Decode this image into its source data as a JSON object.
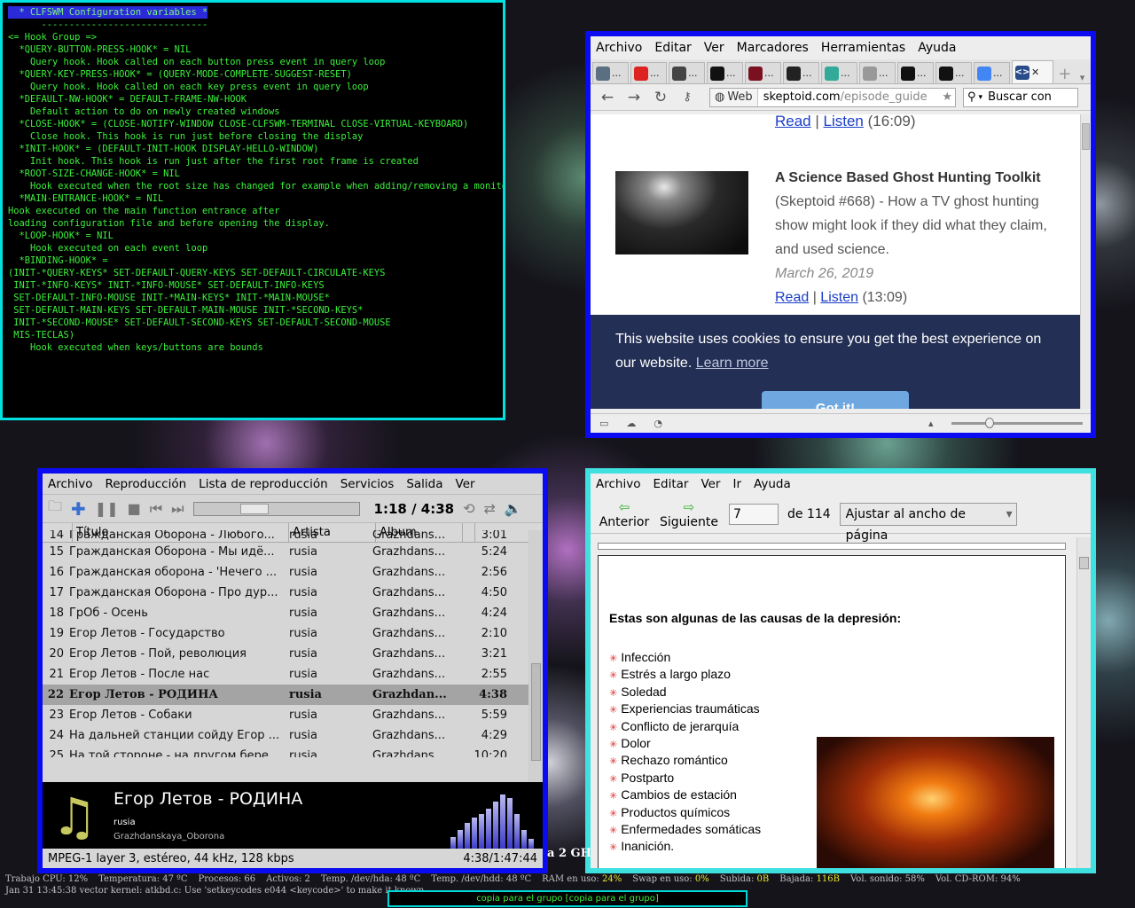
{
  "terminal": {
    "lines": [
      "  * CLFSWM Configuration variables *",
      "      ------------------------------",
      "",
      "<= Hook Group =>",
      "",
      "  *QUERY-BUTTON-PRESS-HOOK* = NIL",
      "    Query hook. Hook called on each button press event in query loop",
      "  *QUERY-KEY-PRESS-HOOK* = (QUERY-MODE-COMPLETE-SUGGEST-RESET)",
      "    Query hook. Hook called on each key press event in query loop",
      "  *DEFAULT-NW-HOOK* = DEFAULT-FRAME-NW-HOOK",
      "    Default action to do on newly created windows",
      "  *CLOSE-HOOK* = (CLOSE-NOTIFY-WINDOW CLOSE-CLFSWM-TERMINAL CLOSE-VIRTUAL-KEYBOARD)",
      "    Close hook. This hook is run just before closing the display",
      "  *INIT-HOOK* = (DEFAULT-INIT-HOOK DISPLAY-HELLO-WINDOW)",
      "    Init hook. This hook is run just after the first root frame is created",
      "  *ROOT-SIZE-CHANGE-HOOK* = NIL",
      "    Hook executed when the root size has changed for example when adding/removing a monitor",
      "  *MAIN-ENTRANCE-HOOK* = NIL",
      "",
      "Hook executed on the main function entrance after",
      "loading configuration file and before opening the display.",
      "  *LOOP-HOOK* = NIL",
      "    Hook executed on each event loop",
      "  *BINDING-HOOK* =",
      "(INIT-*QUERY-KEYS* SET-DEFAULT-QUERY-KEYS SET-DEFAULT-CIRCULATE-KEYS",
      " INIT-*INFO-KEYS* INIT-*INFO-MOUSE* SET-DEFAULT-INFO-KEYS",
      " SET-DEFAULT-INFO-MOUSE INIT-*MAIN-KEYS* INIT-*MAIN-MOUSE*",
      " SET-DEFAULT-MAIN-KEYS SET-DEFAULT-MAIN-MOUSE INIT-*SECOND-KEYS*",
      " INIT-*SECOND-MOUSE* SET-DEFAULT-SECOND-KEYS SET-DEFAULT-SECOND-MOUSE",
      " MIS-TECLAS)",
      "    Hook executed when keys/buttons are bounds"
    ]
  },
  "browser": {
    "menu": [
      "Archivo",
      "Editar",
      "Ver",
      "Marcadores",
      "Herramientas",
      "Ayuda"
    ],
    "tabs": [
      {
        "icon": "disk-icon",
        "color": "#5a6f82",
        "label": "..."
      },
      {
        "icon": "x-icon",
        "color": "#d22",
        "label": "..."
      },
      {
        "icon": "go-icon",
        "color": "#444",
        "label": "..."
      },
      {
        "icon": "at-icon",
        "color": "#111",
        "label": "..."
      },
      {
        "icon": "bug-icon",
        "color": "#7a1020",
        "label": "..."
      },
      {
        "icon": "github-icon",
        "color": "#222",
        "label": "..."
      },
      {
        "icon": "globe-icon",
        "color": "#3a9",
        "label": "..."
      },
      {
        "icon": "page-icon",
        "color": "#999",
        "label": "..."
      },
      {
        "icon": "t-icon",
        "color": "#111",
        "label": "..."
      },
      {
        "icon": "t-icon",
        "color": "#111",
        "label": "..."
      },
      {
        "icon": "google-icon",
        "color": "#4285f4",
        "label": "..."
      }
    ],
    "web_label": "Web",
    "url": "skeptoid.com",
    "url_rest": "/episode_guide",
    "search_placeholder": "Buscar con",
    "prev_read": "Read",
    "prev_listen": "Listen",
    "prev_duration": "(16:09)",
    "article_title": "A Science Based Ghost Hunting Toolkit",
    "article_desc": "(Skeptoid #668) - How a TV ghost hunting show might look if they did what they claim, and used science.",
    "article_date": "March 26, 2019",
    "read": "Read",
    "listen": "Listen",
    "duration": "(13:09)",
    "cookie_text": "This website uses cookies to ensure you get the best experience on our website.",
    "learn_more": "Learn more",
    "got_it": "Got it!"
  },
  "player": {
    "menu": [
      "Archivo",
      "Reproducción",
      "Lista de reproducción",
      "Servicios",
      "Salida",
      "Ver"
    ],
    "time": "1:18 / 4:38",
    "seek_fraction": 0.28,
    "columns": [
      "Título",
      "Artista",
      "Album"
    ],
    "rows": [
      {
        "n": "14",
        "t": "Гражданская Оборона - Любого...",
        "a": "rusia",
        "al": "Grazhdans...",
        "d": "3:01"
      },
      {
        "n": "15",
        "t": "Гражданская Оборона - Мы идё...",
        "a": "rusia",
        "al": "Grazhdans...",
        "d": "5:24"
      },
      {
        "n": "16",
        "t": "Гражданская оборона - 'Нечего ...",
        "a": "rusia",
        "al": "Grazhdans...",
        "d": "2:56"
      },
      {
        "n": "17",
        "t": "Гражданская Оборона - Про дур...",
        "a": "rusia",
        "al": "Grazhdans...",
        "d": "4:50"
      },
      {
        "n": "18",
        "t": "ГрОб - Осень",
        "a": "rusia",
        "al": "Grazhdans...",
        "d": "4:24"
      },
      {
        "n": "19",
        "t": "Егор Летов - Государство",
        "a": "rusia",
        "al": "Grazhdans...",
        "d": "2:10"
      },
      {
        "n": "20",
        "t": "Егор Летов - Пой, революция",
        "a": "rusia",
        "al": "Grazhdans...",
        "d": "3:21"
      },
      {
        "n": "21",
        "t": "Егор Летов - После нас",
        "a": "rusia",
        "al": "Grazhdans...",
        "d": "2:55"
      },
      {
        "n": "22",
        "t": "Егор Летов - РОДИНА",
        "a": "rusia",
        "al": "Grazhdan...",
        "d": "4:38",
        "current": true
      },
      {
        "n": "23",
        "t": "Егор Летов - Собаки",
        "a": "rusia",
        "al": "Grazhdans...",
        "d": "5:59"
      },
      {
        "n": "24",
        "t": "На дальней станции сойду Егор ...",
        "a": "rusia",
        "al": "Grazhdans...",
        "d": "4:29"
      },
      {
        "n": "25",
        "t": "На той стороне - на другом бере...",
        "a": "rusia",
        "al": "Grazhdans...",
        "d": "10:20"
      }
    ],
    "now_title": "Егор Летов - РОДИНА",
    "now_artist": "rusia",
    "now_album": "Grazhdanskaya_Oborona",
    "format": "MPEG-1 layer 3, estéreo, 44 kHz, 128 kbps",
    "total": "4:38/1:47:44"
  },
  "viewer": {
    "menu": [
      "Archivo",
      "Editar",
      "Ver",
      "Ir",
      "Ayuda"
    ],
    "prev_label": "Anterior",
    "next_label": "Siguiente",
    "page": "7",
    "of": "de 114",
    "zoom": "Ajustar al ancho de página",
    "heading": "Estas son algunas de las causas de la depresión:",
    "items": [
      "Infección",
      "Estrés a largo plazo",
      "Soledad",
      "Experiencias traumáticas",
      "Conflicto de jerarquía",
      "Dolor",
      "Rechazo romántico",
      "Postparto",
      "Cambios de estación",
      "Productos químicos",
      "Enfermedades somáticas",
      "Inanición."
    ]
  },
  "desktop": {
    "overlay_text": "a 2 GH",
    "status": [
      {
        "k": "Trabajo CPU: ",
        "v": "12%",
        "y": false
      },
      {
        "k": "Temperatura: ",
        "v": "47 ºC",
        "y": false
      },
      {
        "k": "Procesos: ",
        "v": "66",
        "y": false
      },
      {
        "k": "Activos: ",
        "v": "2",
        "y": false
      },
      {
        "k": "Temp. /dev/hda: ",
        "v": "48 ºC",
        "y": false
      },
      {
        "k": "Temp. /dev/hdd: ",
        "v": "48 ºC",
        "y": false
      },
      {
        "k": "RAM en uso: ",
        "v": "24%",
        "y": true
      },
      {
        "k": "Swap en uso: ",
        "v": "0%",
        "y": true
      },
      {
        "k": "Subida: ",
        "v": "0B",
        "y": true
      },
      {
        "k": "Bajada: ",
        "v": "116B",
        "y": true
      },
      {
        "k": "Vol. sonido: ",
        "v": "58%",
        "y": false
      },
      {
        "k": "Vol. CD-ROM: ",
        "v": "94%",
        "y": false
      }
    ],
    "log_line": "Jan 31 13:45:38 vector kernel: atkbd.c: Use 'setkeycodes e044 <keycode>' to make it known.",
    "group_label": "copia para el grupo [copia para el grupo]"
  }
}
